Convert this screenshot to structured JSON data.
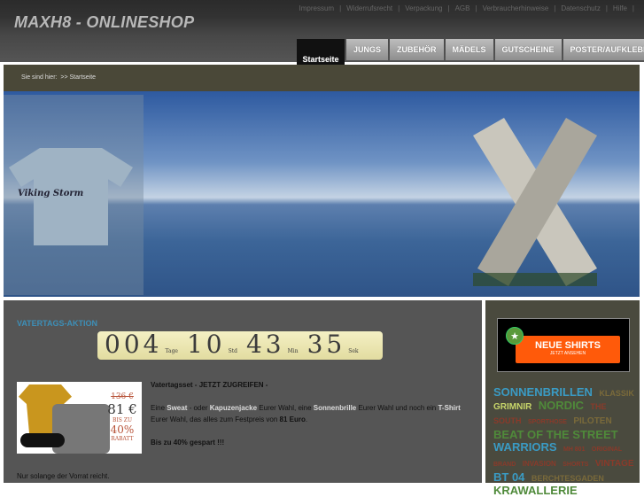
{
  "header": {
    "logo": "MAXH8 - ONLINESHOP",
    "toplinks": [
      "Impressum",
      "Widerrufsrecht",
      "Verpackung",
      "AGB",
      "Verbraucherhinweise",
      "Datenschutz",
      "Hilfe"
    ],
    "separator": "|"
  },
  "nav": [
    "Startseite",
    "JUNGS",
    "ZUBEHÖR",
    "MÄDELS",
    "GUTSCHEINE",
    "POSTER/AUFKLEBER"
  ],
  "breadcrumb": {
    "label": "Sie sind hier:",
    "path": ">> Startseite"
  },
  "banner": {
    "shirt_text": "Viking Storm"
  },
  "promo": {
    "title": "VATERTAGS-AKTION",
    "countdown": {
      "days": "004",
      "days_label": "Tage",
      "hours": "10",
      "hours_label": "Std",
      "minutes": "43",
      "minutes_label": "Min",
      "seconds": "35",
      "seconds_label": "Sek"
    },
    "image": {
      "old_price": "136 €",
      "new_price": "81 €",
      "discount1": "BIS ZU",
      "discount2": "40%",
      "discount3": "RABATT"
    },
    "headline": "Vatertagsset - JETZT ZUGREIFEN -",
    "body": {
      "t1": "Eine ",
      "sweat": "Sweat",
      "t2": " - oder ",
      "kapuze": "Kapuzenjacke",
      "t3": " Eurer Wahl, eine ",
      "brille": "Sonnenbrille",
      "t4": " Eurer Wahl und noch ein ",
      "tshirt": "T-Shirt",
      "t5": " Eurer Wahl, das alles zum Festpreis von ",
      "price": "81 Euro",
      "t6": "."
    },
    "saving": "Bis zu 40% gespart !!!",
    "footer": "Nur solange der Vorrat reicht."
  },
  "sidebar": {
    "new_title": "NEUE SHIRTS",
    "new_sub": "JETZT ANSEHEN",
    "tags": [
      {
        "text": "SONNENBRILLEN",
        "color": "#3a9bc4",
        "size": 13
      },
      {
        "text": "KLASSIK",
        "color": "#7a6a3a",
        "size": 9
      },
      {
        "text": "GRIMNIR",
        "color": "#c8d66a",
        "size": 10
      },
      {
        "text": "NORDIC",
        "color": "#4f8a3a",
        "size": 13
      },
      {
        "text": "THE SOUTH",
        "color": "#8a3a2a",
        "size": 9
      },
      {
        "text": "SPORTHOSE",
        "color": "#8a3a2a",
        "size": 7
      },
      {
        "text": "PILOTEN",
        "color": "#7a6a3a",
        "size": 10
      },
      {
        "text": "BEAT OF THE STREET",
        "color": "#4f8a3a",
        "size": 13
      },
      {
        "text": "WARRIORS",
        "color": "#3a9bc4",
        "size": 13
      },
      {
        "text": "MH 801",
        "color": "#8a3a2a",
        "size": 7
      },
      {
        "text": "ORIGINAL BRAND",
        "color": "#8a3a2a",
        "size": 7
      },
      {
        "text": "INVASION",
        "color": "#8a3a2a",
        "size": 8
      },
      {
        "text": "SHORTS",
        "color": "#8a3a2a",
        "size": 7
      },
      {
        "text": "VINTAGE",
        "color": "#8a3a2a",
        "size": 10
      },
      {
        "text": "BT 04",
        "color": "#3a9bc4",
        "size": 13
      },
      {
        "text": "BERCHTESGADEN",
        "color": "#7a6a3a",
        "size": 9
      },
      {
        "text": "KRAWALLERIE",
        "color": "#4f8a3a",
        "size": 13
      }
    ]
  }
}
